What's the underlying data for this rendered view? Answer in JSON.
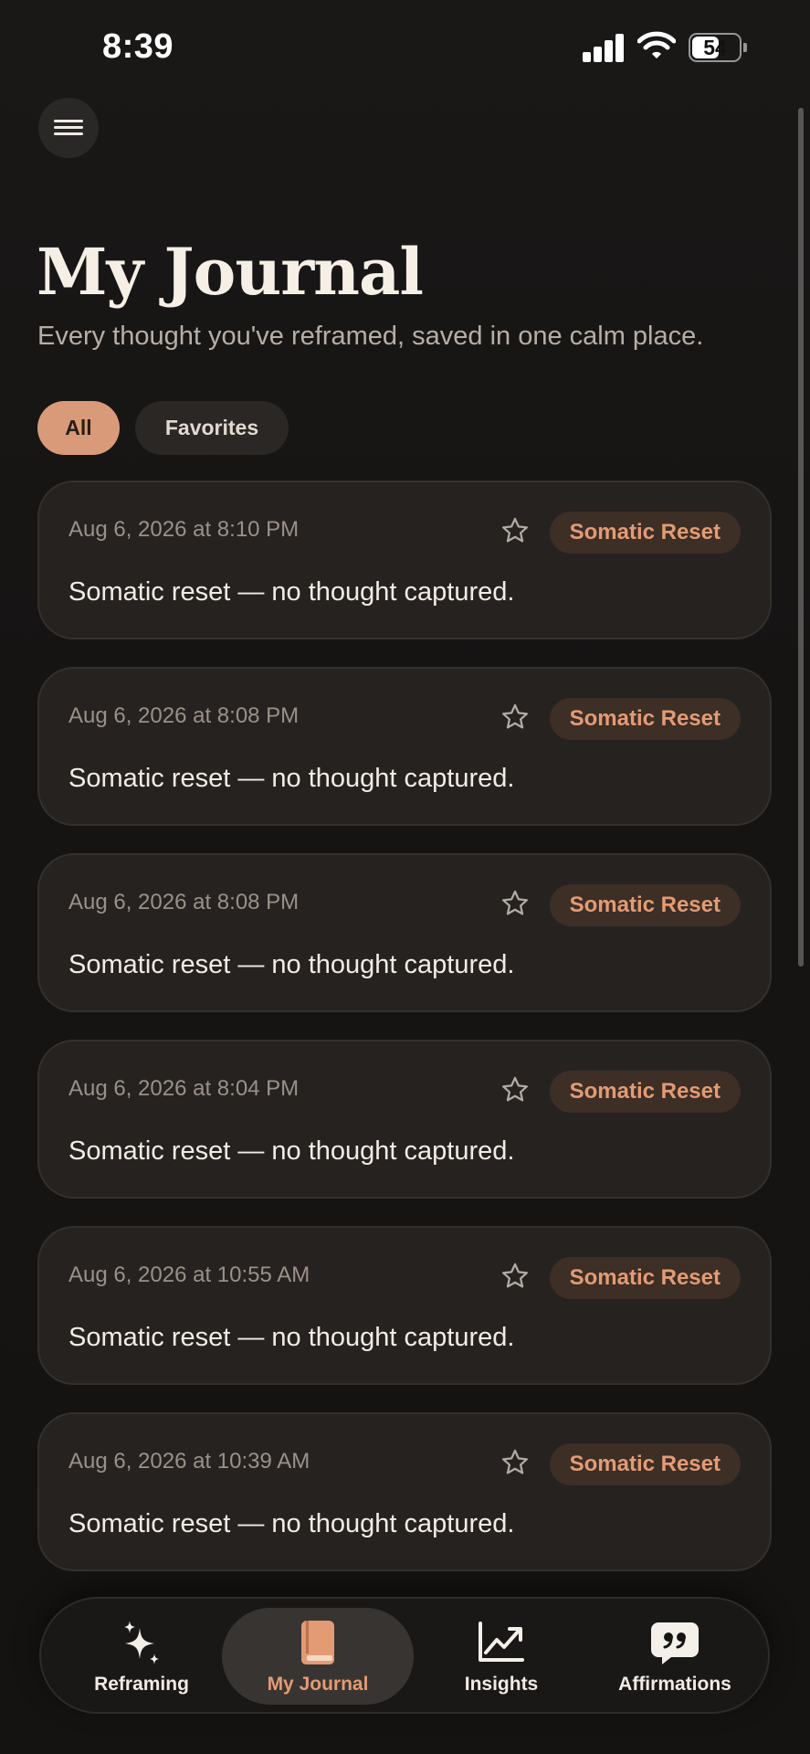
{
  "status_bar": {
    "time": "8:39",
    "battery": "54",
    "battery_level": 0.54
  },
  "header": {
    "title": "My Journal",
    "subtitle": "Every thought you've reframed, saved in one calm place."
  },
  "filters": {
    "all": "All",
    "favorites": "Favorites",
    "selected": "All"
  },
  "entries": [
    {
      "date": "Aug 6, 2026 at 8:10 PM",
      "tag": "Somatic Reset",
      "text": "Somatic reset — no thought captured."
    },
    {
      "date": "Aug 6, 2026 at 8:08 PM",
      "tag": "Somatic Reset",
      "text": "Somatic reset — no thought captured."
    },
    {
      "date": "Aug 6, 2026 at 8:08 PM",
      "tag": "Somatic Reset",
      "text": "Somatic reset — no thought captured."
    },
    {
      "date": "Aug 6, 2026 at 8:04 PM",
      "tag": "Somatic Reset",
      "text": "Somatic reset — no thought captured."
    },
    {
      "date": "Aug 6, 2026 at 10:55 AM",
      "tag": "Somatic Reset",
      "text": "Somatic reset — no thought captured."
    },
    {
      "date": "Aug 6, 2026 at 10:39 AM",
      "tag": "Somatic Reset",
      "text": "Somatic reset — no thought captured."
    }
  ],
  "nav": {
    "items": [
      {
        "label": "Reframing",
        "icon": "sparkles-icon"
      },
      {
        "label": "My Journal",
        "icon": "book-icon"
      },
      {
        "label": "Insights",
        "icon": "chart-line-icon"
      },
      {
        "label": "Affirmations",
        "icon": "quote-bubble-icon"
      }
    ],
    "active": "My Journal"
  },
  "colors": {
    "accent": "#e39b74",
    "accent_fill": "#d89a78",
    "background": "#161413",
    "card": "#262220"
  }
}
